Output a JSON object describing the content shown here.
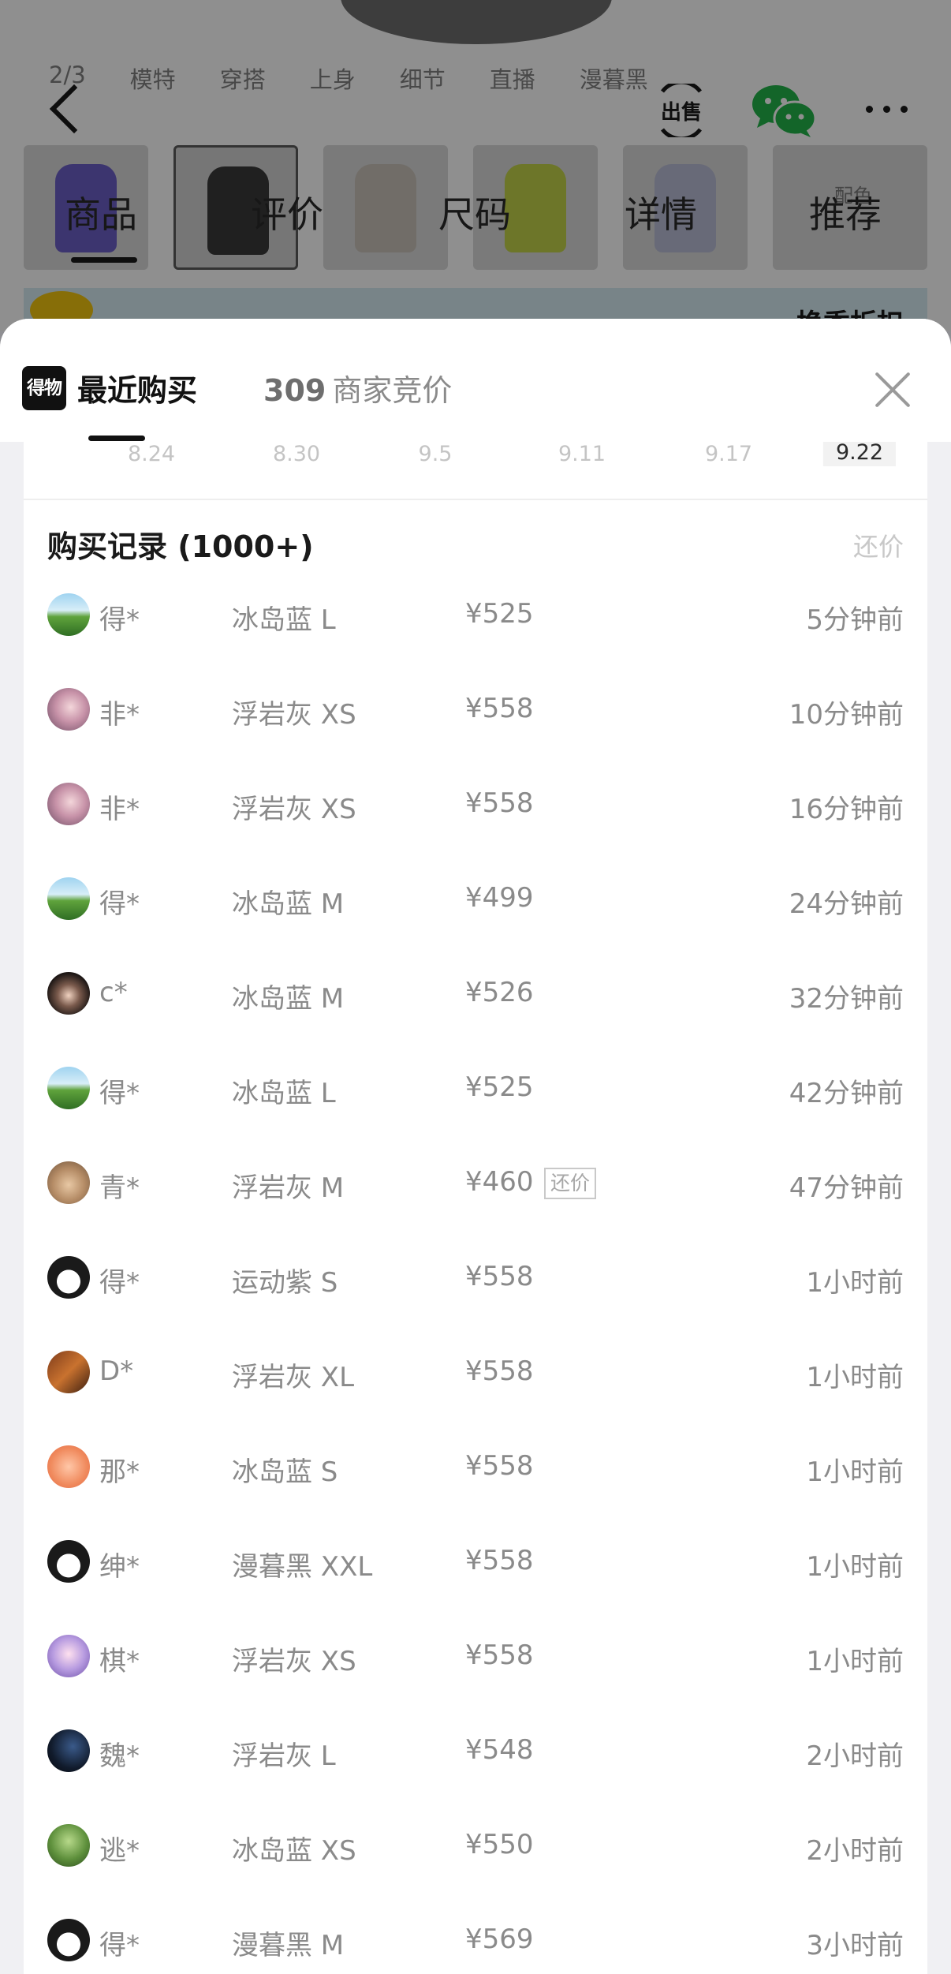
{
  "background_page": {
    "media_tabs": [
      "2/3",
      "模特",
      "穿搭",
      "上身",
      "细节",
      "直播",
      "漫暮黑"
    ],
    "nav_tabs": [
      "商品",
      "评价",
      "尺码",
      "详情",
      "推荐"
    ],
    "sell_label": "出售",
    "color_thumb_side_label": "配色",
    "banner_text": "换季折扣"
  },
  "sheet": {
    "brand_logo_text": "得物",
    "tab_recent_label": "最近购买",
    "merchant_count": "309",
    "tab_merchant_label": "商家竞价",
    "dates": [
      "8.24",
      "8.30",
      "9.5",
      "9.11",
      "9.17",
      "9.22"
    ],
    "active_date": "9.22",
    "records_title": "购买记录 (1000+)",
    "counter_offer_link": "还价"
  },
  "records": [
    {
      "buyer": "得*",
      "sku": "冰岛蓝 L",
      "price": "¥525",
      "badge": "",
      "time": "5分钟前",
      "avatar": "landscape"
    },
    {
      "buyer": "非*",
      "sku": "浮岩灰 XS",
      "price": "¥558",
      "badge": "",
      "time": "10分钟前",
      "avatar": "pink-portrait"
    },
    {
      "buyer": "非*",
      "sku": "浮岩灰 XS",
      "price": "¥558",
      "badge": "",
      "time": "16分钟前",
      "avatar": "pink-portrait"
    },
    {
      "buyer": "得*",
      "sku": "冰岛蓝 M",
      "price": "¥499",
      "badge": "",
      "time": "24分钟前",
      "avatar": "landscape"
    },
    {
      "buyer": "c*",
      "sku": "冰岛蓝 M",
      "price": "¥526",
      "badge": "",
      "time": "32分钟前",
      "avatar": "dark-portrait"
    },
    {
      "buyer": "得*",
      "sku": "冰岛蓝 L",
      "price": "¥525",
      "badge": "",
      "time": "42分钟前",
      "avatar": "landscape"
    },
    {
      "buyer": "青*",
      "sku": "浮岩灰 M",
      "price": "¥460",
      "badge": "还价",
      "time": "47分钟前",
      "avatar": "beige-portrait"
    },
    {
      "buyer": "得*",
      "sku": "运动紫 S",
      "price": "¥558",
      "badge": "",
      "time": "1小时前",
      "avatar": "cartoon-bw"
    },
    {
      "buyer": "D*",
      "sku": "浮岩灰 XL",
      "price": "¥558",
      "badge": "",
      "time": "1小时前",
      "avatar": "brown-art"
    },
    {
      "buyer": "那*",
      "sku": "冰岛蓝 S",
      "price": "¥558",
      "badge": "",
      "time": "1小时前",
      "avatar": "peach"
    },
    {
      "buyer": "绅*",
      "sku": "漫暮黑 XXL",
      "price": "¥558",
      "badge": "",
      "time": "1小时前",
      "avatar": "cartoon-bw"
    },
    {
      "buyer": "棋*",
      "sku": "浮岩灰 XS",
      "price": "¥558",
      "badge": "",
      "time": "1小时前",
      "avatar": "anime-purple"
    },
    {
      "buyer": "魏*",
      "sku": "浮岩灰 L",
      "price": "¥548",
      "badge": "",
      "time": "2小时前",
      "avatar": "night"
    },
    {
      "buyer": "逃*",
      "sku": "冰岛蓝 XS",
      "price": "¥550",
      "badge": "",
      "time": "2小时前",
      "avatar": "green"
    },
    {
      "buyer": "得*",
      "sku": "漫暮黑 M",
      "price": "¥569",
      "badge": "",
      "time": "3小时前",
      "avatar": "cartoon-bw"
    }
  ]
}
